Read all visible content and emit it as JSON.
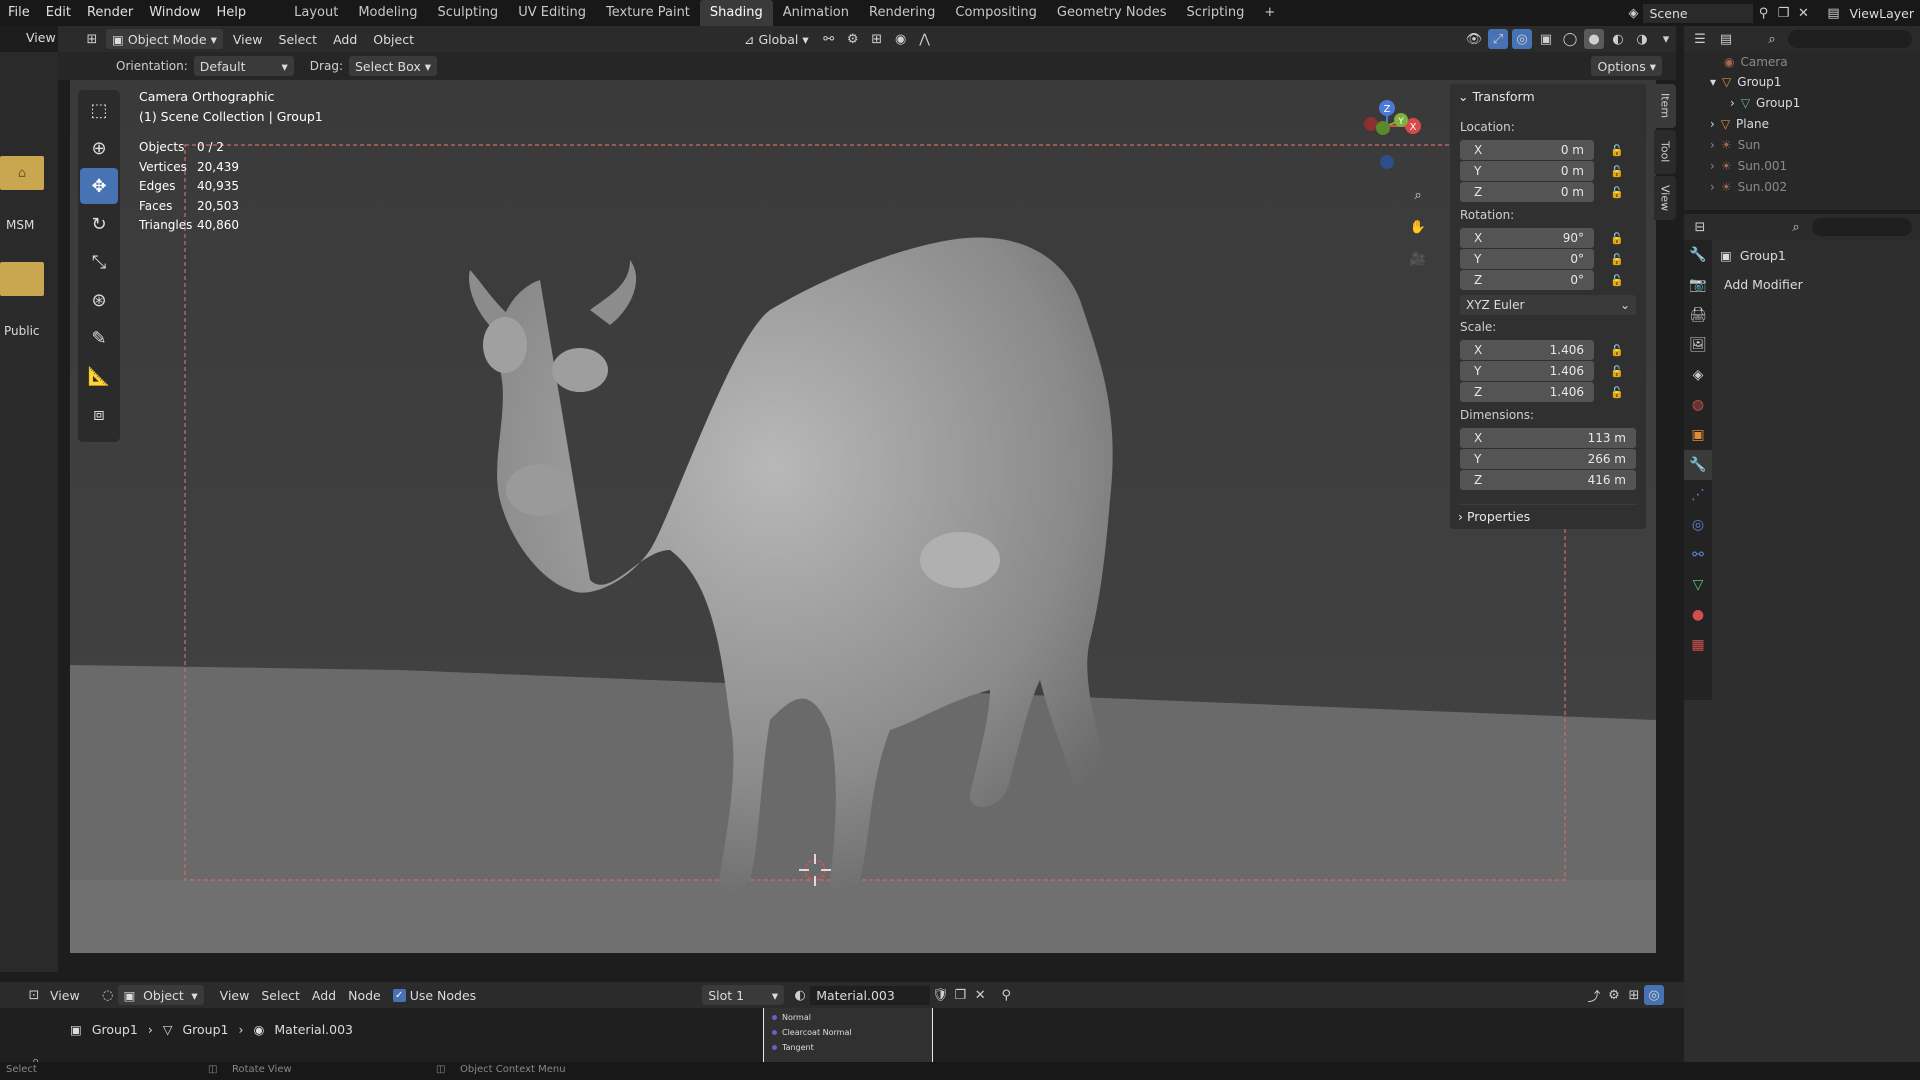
{
  "menu": {
    "items": [
      "File",
      "Edit",
      "Render",
      "Window",
      "Help"
    ]
  },
  "workspaces": [
    "Layout",
    "Modeling",
    "Sculpting",
    "UV Editing",
    "Texture Paint",
    "Shading",
    "Animation",
    "Rendering",
    "Compositing",
    "Geometry Nodes",
    "Scripting"
  ],
  "active_workspace": "Shading",
  "scene_name": "Scene",
  "view_layer": "ViewLayer",
  "viewport_header": {
    "mode": "Object Mode",
    "view": "View",
    "select": "Select",
    "add": "Add",
    "object": "Object",
    "transform_orientation": "Global"
  },
  "tool_settings": {
    "orientation_label": "Orientation:",
    "orientation_value": "Default",
    "drag_label": "Drag:",
    "drag_value": "Select Box",
    "options": "Options"
  },
  "left_strip": {
    "view": "View",
    "msm": "MSM",
    "public": "Public"
  },
  "overlay": {
    "camera": "Camera Orthographic",
    "collection": "(1) Scene Collection | Group1"
  },
  "stats": [
    {
      "label": "Objects",
      "value": "0 / 2"
    },
    {
      "label": "Vertices",
      "value": "20,439"
    },
    {
      "label": "Edges",
      "value": "40,935"
    },
    {
      "label": "Faces",
      "value": "20,503"
    },
    {
      "label": "Triangles",
      "value": "40,860"
    }
  ],
  "transform": {
    "title": "Transform",
    "location_label": "Location:",
    "location": [
      {
        "axis": "X",
        "value": "0 m"
      },
      {
        "axis": "Y",
        "value": "0 m"
      },
      {
        "axis": "Z",
        "value": "0 m"
      }
    ],
    "rotation_label": "Rotation:",
    "rotation": [
      {
        "axis": "X",
        "value": "90°"
      },
      {
        "axis": "Y",
        "value": "0°"
      },
      {
        "axis": "Z",
        "value": "0°"
      }
    ],
    "rotation_mode": "XYZ Euler",
    "scale_label": "Scale:",
    "scale": [
      {
        "axis": "X",
        "value": "1.406"
      },
      {
        "axis": "Y",
        "value": "1.406"
      },
      {
        "axis": "Z",
        "value": "1.406"
      }
    ],
    "dimensions_label": "Dimensions:",
    "dimensions": [
      {
        "axis": "X",
        "value": "113 m"
      },
      {
        "axis": "Y",
        "value": "266 m"
      },
      {
        "axis": "Z",
        "value": "416 m"
      }
    ],
    "properties": "Properties"
  },
  "side_tabs": [
    "Item",
    "Tool",
    "View"
  ],
  "outliner": [
    {
      "name": "Camera",
      "indent": 1,
      "dim": true
    },
    {
      "name": "Group1",
      "indent": 0,
      "dim": false
    },
    {
      "name": "Group1",
      "indent": 1,
      "dim": false
    },
    {
      "name": "Plane",
      "indent": 0,
      "dim": false
    },
    {
      "name": "Sun",
      "indent": 0,
      "dim": true
    },
    {
      "name": "Sun.001",
      "indent": 0,
      "dim": true
    },
    {
      "name": "Sun.002",
      "indent": 0,
      "dim": true
    }
  ],
  "properties_panel": {
    "object_name": "Group1",
    "add_modifier": "Add Modifier"
  },
  "node_editor": {
    "view": "View",
    "object": "Object",
    "view_menu": "View",
    "select": "Select",
    "add": "Add",
    "node": "Node",
    "use_nodes": "Use Nodes",
    "slot": "Slot 1",
    "material": "Material.003",
    "breadcrumb": [
      "Group1",
      "Group1",
      "Material.003"
    ],
    "sockets": [
      "Normal",
      "Clearcoat Normal",
      "Tangent"
    ]
  },
  "status_bar": {
    "select": "Select",
    "rotate": "Rotate View",
    "context": "Object Context Menu"
  },
  "colors": {
    "accent": "#4772b3",
    "active_tab": "#3a3a3a",
    "viewport_bg": "#3d3d3d",
    "floor": "#6a6a6a",
    "camera_frame": "#d06a6a"
  }
}
